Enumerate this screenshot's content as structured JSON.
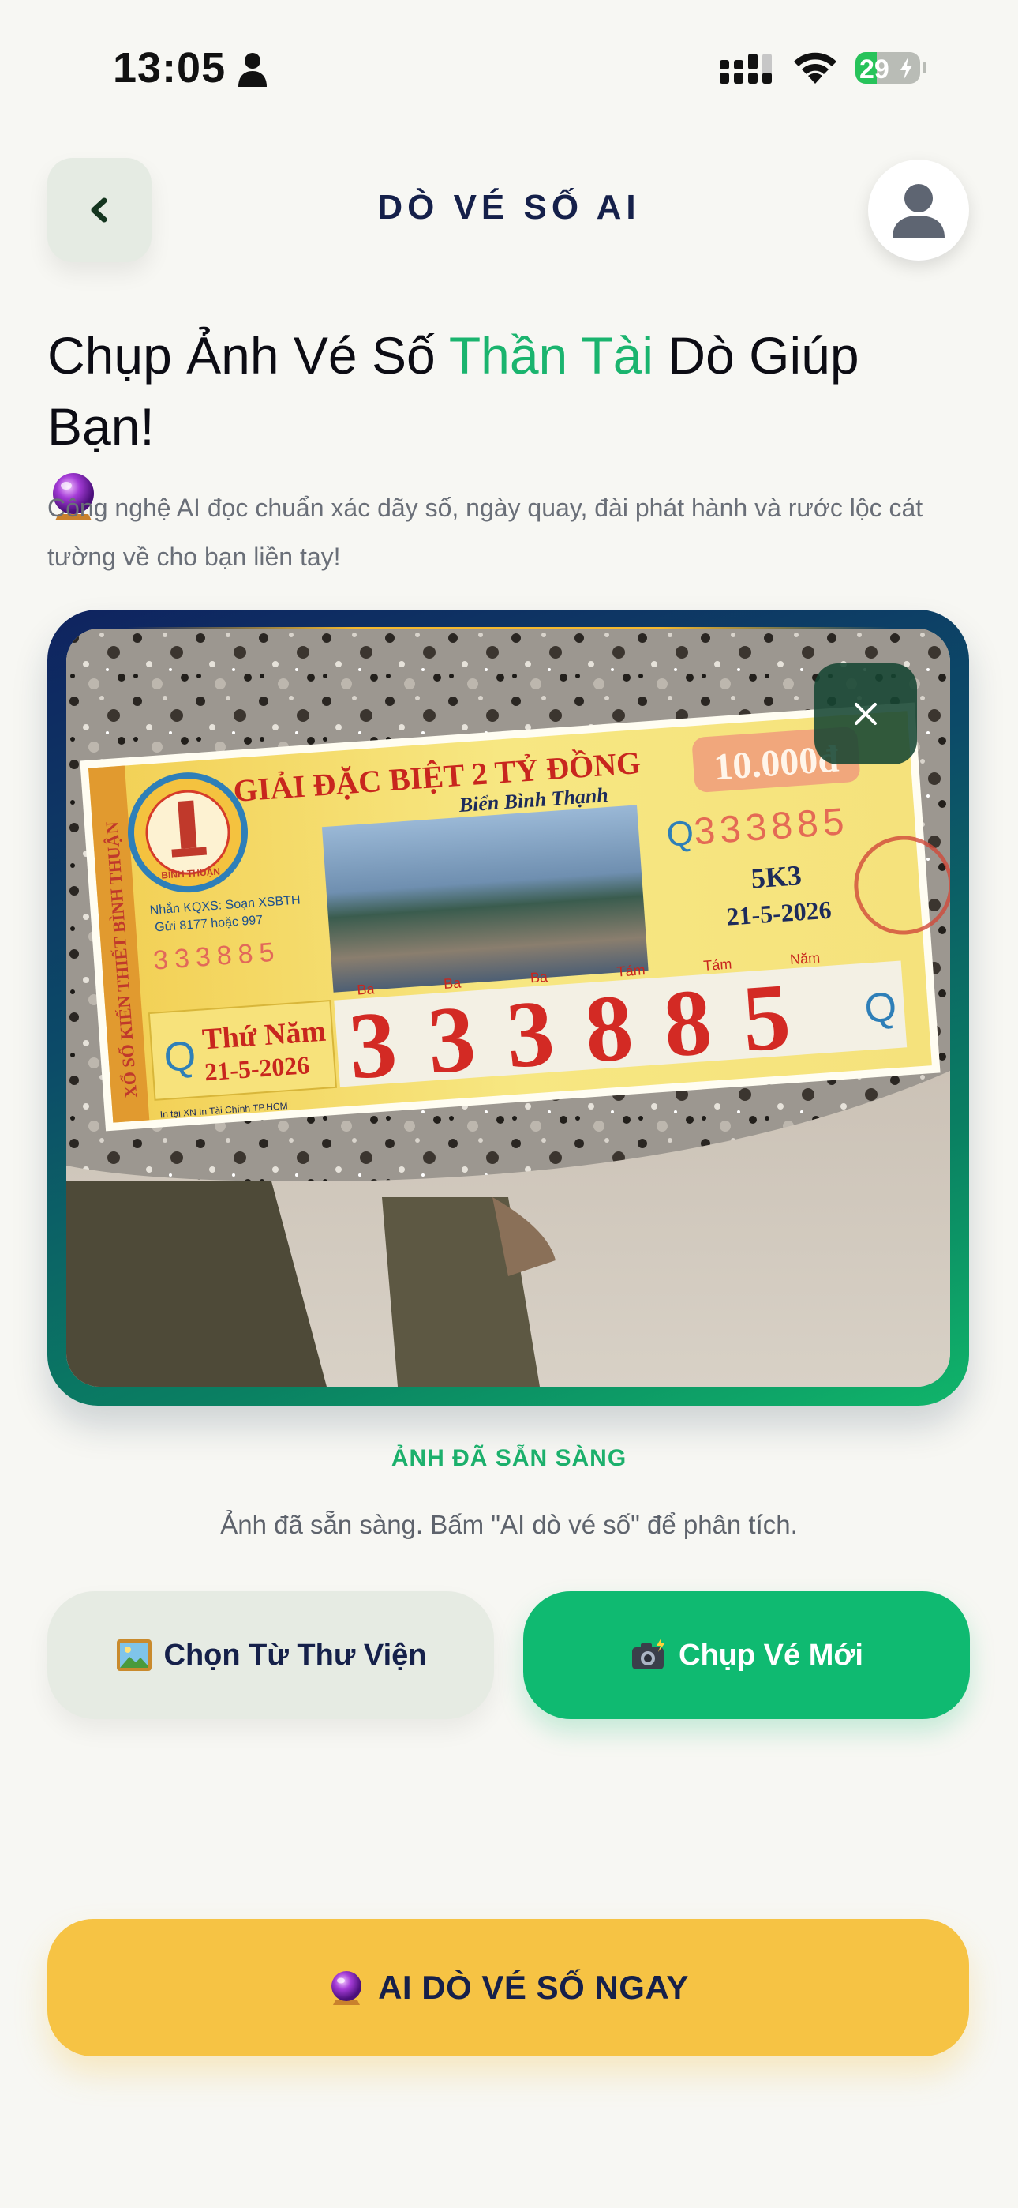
{
  "status_bar": {
    "time": "13:05",
    "battery": "29",
    "icons": [
      "person-icon",
      "signal-icon",
      "wifi-icon",
      "battery-charging-icon"
    ]
  },
  "header": {
    "title": "DÒ VÉ SỐ AI",
    "back_icon": "chevron-left-icon",
    "avatar_icon": "user-avatar-icon"
  },
  "headline": {
    "part1": "Chụp Ảnh Vé Số ",
    "highlight": "Thần Tài",
    "part2": " Dò Giúp Bạn!",
    "emoji_icon": "crystal-ball-icon"
  },
  "subtext": "Công nghệ AI đọc chuẩn xác dãy số, ngày quay, đài phát hành và rước lộc cát tường về cho bạn liền tay!",
  "ticket": {
    "prize": "GIẢI ĐẶC BIỆT 2 TỶ ĐỒNG",
    "value": "10.000đ",
    "place": "Biển Bình Thạnh",
    "series": "5K3",
    "date": "21-5-2026",
    "weekday": "Thứ Năm",
    "number": "333885",
    "number_prefix": "Q",
    "sms_line1": "Nhắn KQXS: Soạn XSBTH",
    "sms_line2": "Gửi 8177 hoặc 997",
    "printer": "In tại XN In Tài Chính TP.HCM",
    "side_text": "XỔ SỐ KIẾN THIẾT BÌNH THUẬN",
    "seal_text": "BÌNH THUẬN",
    "digit_words": [
      "Ba",
      "Ba",
      "Ba",
      "Tám",
      "Tám",
      "Năm"
    ]
  },
  "photo": {
    "close_icon": "close-icon",
    "ready_label": "ẢNH ĐÃ SẴN SÀNG",
    "ready_hint": "Ảnh đã sẵn sàng. Bấm \"AI dò vé số\" để phân tích."
  },
  "actions": {
    "library_label": "Chọn Từ Thư Viện",
    "library_icon": "picture-icon",
    "camera_label": "Chụp Vé Mới",
    "camera_icon": "camera-flash-icon",
    "cta_label": "AI DÒ VÉ SỐ NGAY",
    "cta_icon": "crystal-ball-icon"
  },
  "colors": {
    "accent_green": "#0fba71",
    "cta_yellow": "#f6c344",
    "navy": "#15204a",
    "background": "#f7f7f3"
  }
}
